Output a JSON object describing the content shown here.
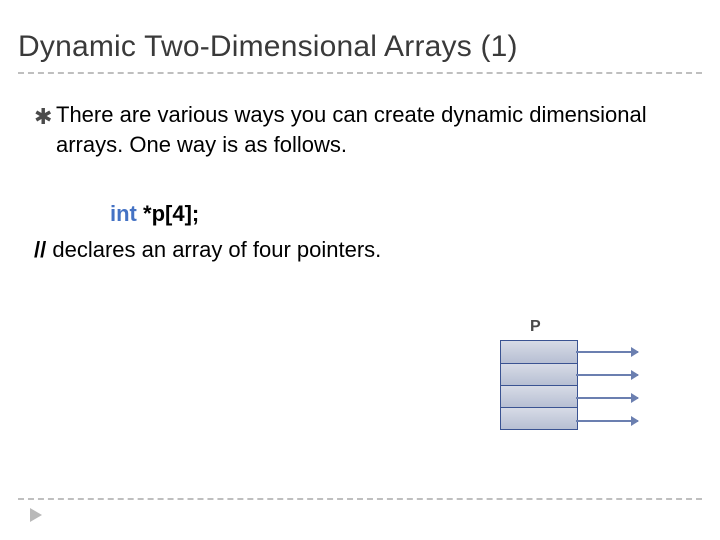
{
  "title": "Dynamic Two-Dimensional Arrays (1)",
  "bullet_char": "✱",
  "bullet_text": "There are various ways you can create dynamic dimensional arrays. One way is as follows.",
  "code": {
    "keyword": "int",
    "rest": " *p[4];"
  },
  "comment": {
    "slashes": "//",
    "text": " declares an array of four pointers."
  },
  "diagram": {
    "label": "P",
    "cell_count": 4
  }
}
